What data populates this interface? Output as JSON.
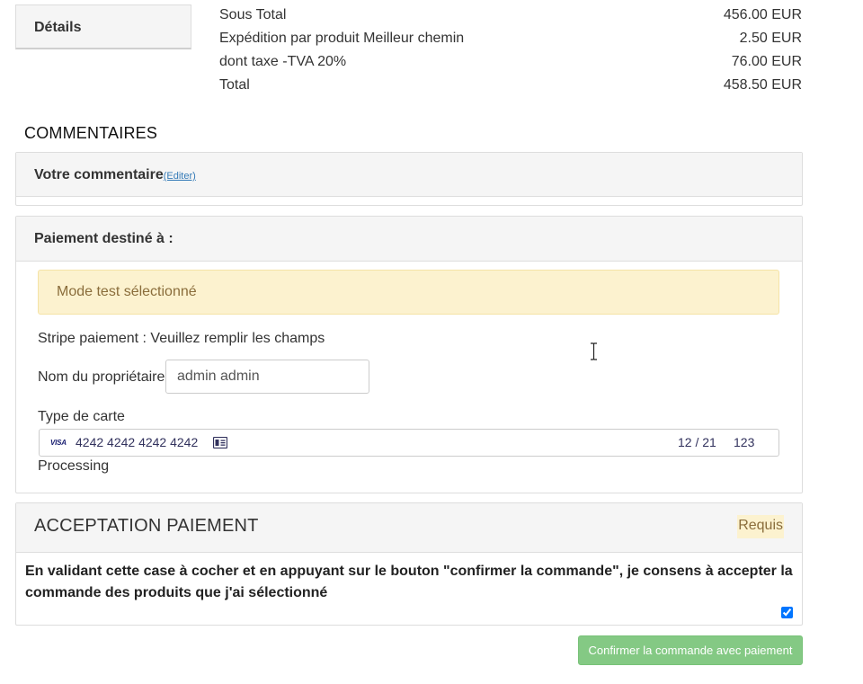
{
  "details_tab": {
    "label": "Détails"
  },
  "totals": [
    {
      "label": "Sous Total",
      "value": "456.00 EUR"
    },
    {
      "label": "Expédition par produit Meilleur chemin",
      "value": "2.50 EUR"
    },
    {
      "label": "dont taxe -TVA 20%",
      "value": "76.00 EUR"
    },
    {
      "label": "Total",
      "value": "458.50 EUR"
    }
  ],
  "comments": {
    "section_title": "COMMENTAIRES",
    "heading": "Votre commentaire",
    "edit_link": "(Editer)"
  },
  "payment": {
    "heading": "Paiement destiné à :",
    "alert": "Mode test sélectionné",
    "stripe_label": "Stripe paiement : Veuillez remplir les champs",
    "owner_label": "Nom du propriétaire",
    "owner_value": "admin admin",
    "card_type_label": "Type de carte",
    "card": {
      "brand": "VISA",
      "number": "4242 4242 4242 4242",
      "expiry": "12 / 21",
      "cvc": "123"
    },
    "status": "Processing"
  },
  "acceptance": {
    "title": "ACCEPTATION PAIEMENT",
    "badge": "Requis",
    "text": "En validant cette case à cocher et en appuyant sur le bouton \"confirmer la commande\", je consens à accepter la commande des produits que j'ai sélectionné",
    "checked": true
  },
  "confirm_button": {
    "label": "Confirmer la commande avec paiement"
  },
  "colors": {
    "success": "#5cb85c",
    "warning_bg": "#fcf2cf",
    "warning_text": "#8a6d3b",
    "link": "#337ab7"
  },
  "icons": [
    "visa-logo-icon",
    "card-id-icon",
    "checkbox-icon",
    "text-cursor-icon"
  ]
}
